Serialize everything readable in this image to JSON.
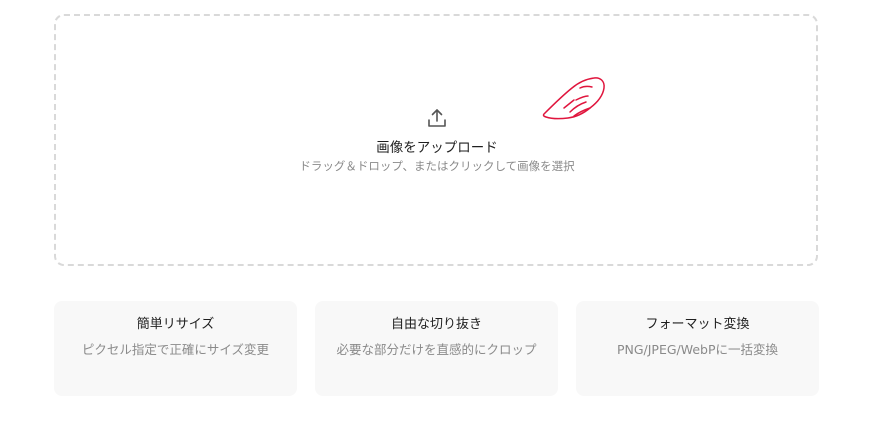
{
  "upload": {
    "title": "画像をアップロード",
    "subtitle": "ドラッグ＆ドロップ、またはクリックして画像を選択",
    "icon": "upload-icon"
  },
  "cursor": {
    "icon": "pointing-hand-icon",
    "color": "#e0153d"
  },
  "features": [
    {
      "title": "簡単リサイズ",
      "description": "ピクセル指定で正確にサイズ変更"
    },
    {
      "title": "自由な切り抜き",
      "description": "必要な部分だけを直感的にクロップ"
    },
    {
      "title": "フォーマット変換",
      "description": "PNG/JPEG/WebPに一括変換"
    }
  ]
}
